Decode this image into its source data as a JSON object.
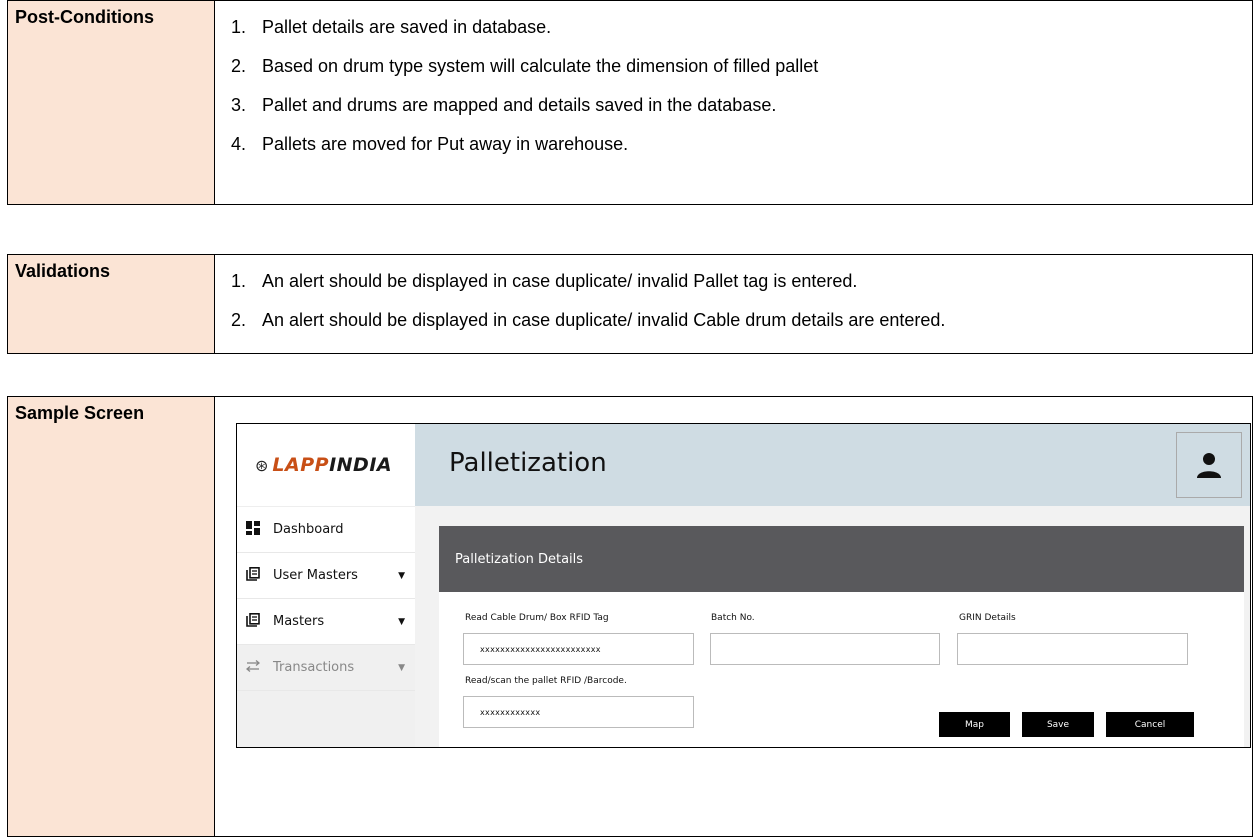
{
  "post_conditions": {
    "label": "Post-Conditions",
    "items": [
      {
        "num": "1.",
        "text": "Pallet details are saved in database."
      },
      {
        "num": "2.",
        "text": "Based on drum type system will calculate the dimension of filled pallet"
      },
      {
        "num": "3.",
        "text": "Pallet and drums are mapped and details saved in the database."
      },
      {
        "num": "4.",
        "text": "Pallets are moved for Put away in warehouse."
      }
    ]
  },
  "validations": {
    "label": "Validations",
    "items": [
      {
        "num": "1.",
        "text": "An alert should be displayed in case duplicate/ invalid Pallet tag is entered."
      },
      {
        "num": "2.",
        "text": "An alert should be displayed in case duplicate/ invalid Cable drum details are entered."
      }
    ]
  },
  "sample_screen": {
    "label": "Sample Screen",
    "app": {
      "logo_part1": "LAPP",
      "logo_part2": "INDIA",
      "page_title": "Palletization",
      "sidebar": [
        {
          "label": "Dashboard",
          "icon": "dashboard-icon"
        },
        {
          "label": "User Masters",
          "icon": "document-icon",
          "caret": "▼"
        },
        {
          "label": "Masters",
          "icon": "document-icon",
          "caret": "▼"
        },
        {
          "label": "Transactions",
          "icon": "transfer-icon",
          "caret": "▼"
        }
      ],
      "card_title": "Palletization  Details",
      "fields": {
        "rfid_label": "Read Cable Drum/ Box RFID Tag",
        "rfid_value": "xxxxxxxxxxxxxxxxxxxxxxxx",
        "batch_label": "Batch No.",
        "batch_value": "",
        "grin_label": "GRIN Details",
        "grin_value": "",
        "pallet_label": "Read/scan the pallet RFID /Barcode.",
        "pallet_value": "xxxxxxxxxxxx"
      },
      "buttons": {
        "map": "Map",
        "save": "Save",
        "cancel": "Cancel"
      }
    }
  }
}
